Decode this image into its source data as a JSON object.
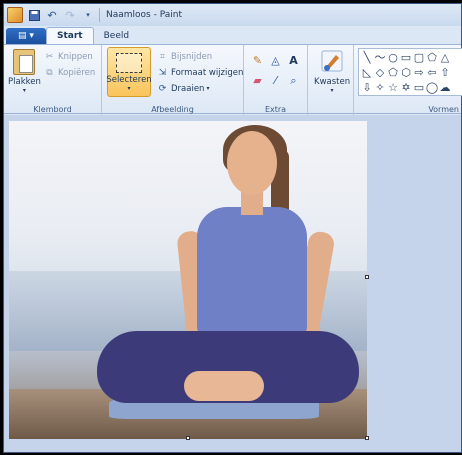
{
  "title_bar": {
    "title": "Naamloos - Paint",
    "save_icon": "save-icon",
    "undo_icon": "undo-icon",
    "redo_icon": "redo-icon"
  },
  "tabs": {
    "menu_label": "▤ ▾",
    "items": [
      {
        "label": "Start",
        "active": true
      },
      {
        "label": "Beeld",
        "active": false
      }
    ]
  },
  "ribbon": {
    "clipboard": {
      "label": "Klembord",
      "paste": "Plakken",
      "cut": "Knippen",
      "copy": "Kopiëren"
    },
    "image": {
      "label": "Afbeelding",
      "select": "Selecteren",
      "crop": "Bijsnijden",
      "resize": "Formaat wijzigen",
      "rotate": "Draaien"
    },
    "tools": {
      "label": "Extra",
      "items": [
        "pencil-icon",
        "fill-icon",
        "text-icon",
        "eraser-icon",
        "color-picker-icon",
        "magnifier-icon"
      ]
    },
    "brushes": {
      "label": "Kwasten"
    },
    "shapes": {
      "label": "Vormen",
      "glyphs": [
        "╲",
        "〜",
        "○",
        "▭",
        "▢",
        "⬠",
        "◁",
        "△",
        "◇",
        "⬠",
        "⬡",
        "⇨",
        "⇦",
        "⇧",
        "⇩",
        "✧",
        "☆",
        "✡",
        "▭",
        "◯",
        "☁",
        "⬜"
      ]
    }
  },
  "colors": {
    "ribbon_bg": "#f5f8fd",
    "workspace_bg": "#c5d4ea",
    "select_highlight": "#f9c45c"
  }
}
